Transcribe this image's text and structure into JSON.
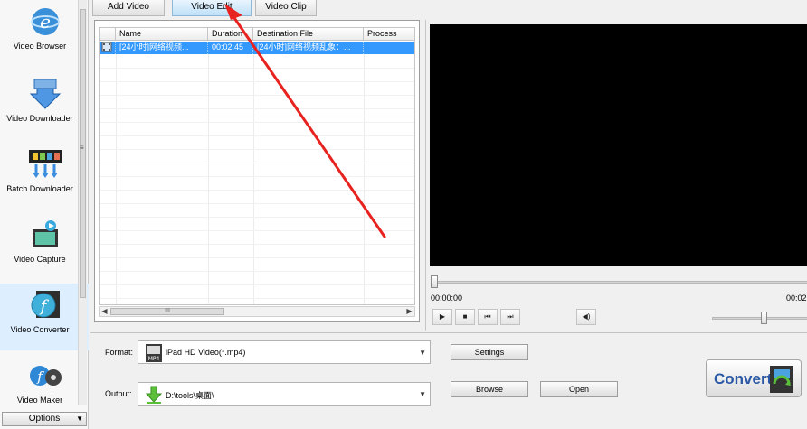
{
  "sidebar": {
    "items": [
      {
        "label": "Video Browser",
        "icon": "globe-e-icon"
      },
      {
        "label": "Video Downloader",
        "icon": "download-arrow-icon"
      },
      {
        "label": "Batch Downloader",
        "icon": "film-batch-download-icon"
      },
      {
        "label": "Video Capture",
        "icon": "video-camera-film-icon"
      },
      {
        "label": "Video Converter",
        "icon": "convert-film-icon"
      },
      {
        "label": "Video Maker",
        "icon": "film-reel-maker-icon"
      }
    ],
    "options_label": "Options"
  },
  "tabs": [
    {
      "label": "Add Video"
    },
    {
      "label": "Video Edit"
    },
    {
      "label": "Video Clip"
    }
  ],
  "file_list": {
    "columns": [
      "Name",
      "Duration",
      "Destination File",
      "Process"
    ],
    "rows": [
      {
        "name": "[24小时]网络视频...",
        "duration": "00:02:45",
        "destination": "[24小时]网络视频乱象：...",
        "process": ""
      }
    ],
    "scroll_thumb_label": "III"
  },
  "player": {
    "current_time": "00:00:00",
    "total_time": "00:02",
    "controls": [
      "play-icon",
      "stop-icon",
      "previous-frame-icon",
      "next-frame-icon",
      "volume-icon"
    ]
  },
  "settings": {
    "format_label": "Format:",
    "format_value": "iPad HD Video(*.mp4)",
    "format_icon_text": "MP4",
    "output_label": "Output:",
    "output_value": "D:\\tools\\桌面\\",
    "settings_button": "Settings",
    "browse_button": "Browse",
    "open_button": "Open",
    "convert_button": "Convert"
  },
  "colors": {
    "selection": "#3399ff",
    "active_tab": "#bfe0f7",
    "annotation_arrow": "#e8231f",
    "convert_text": "#2a58a6"
  }
}
